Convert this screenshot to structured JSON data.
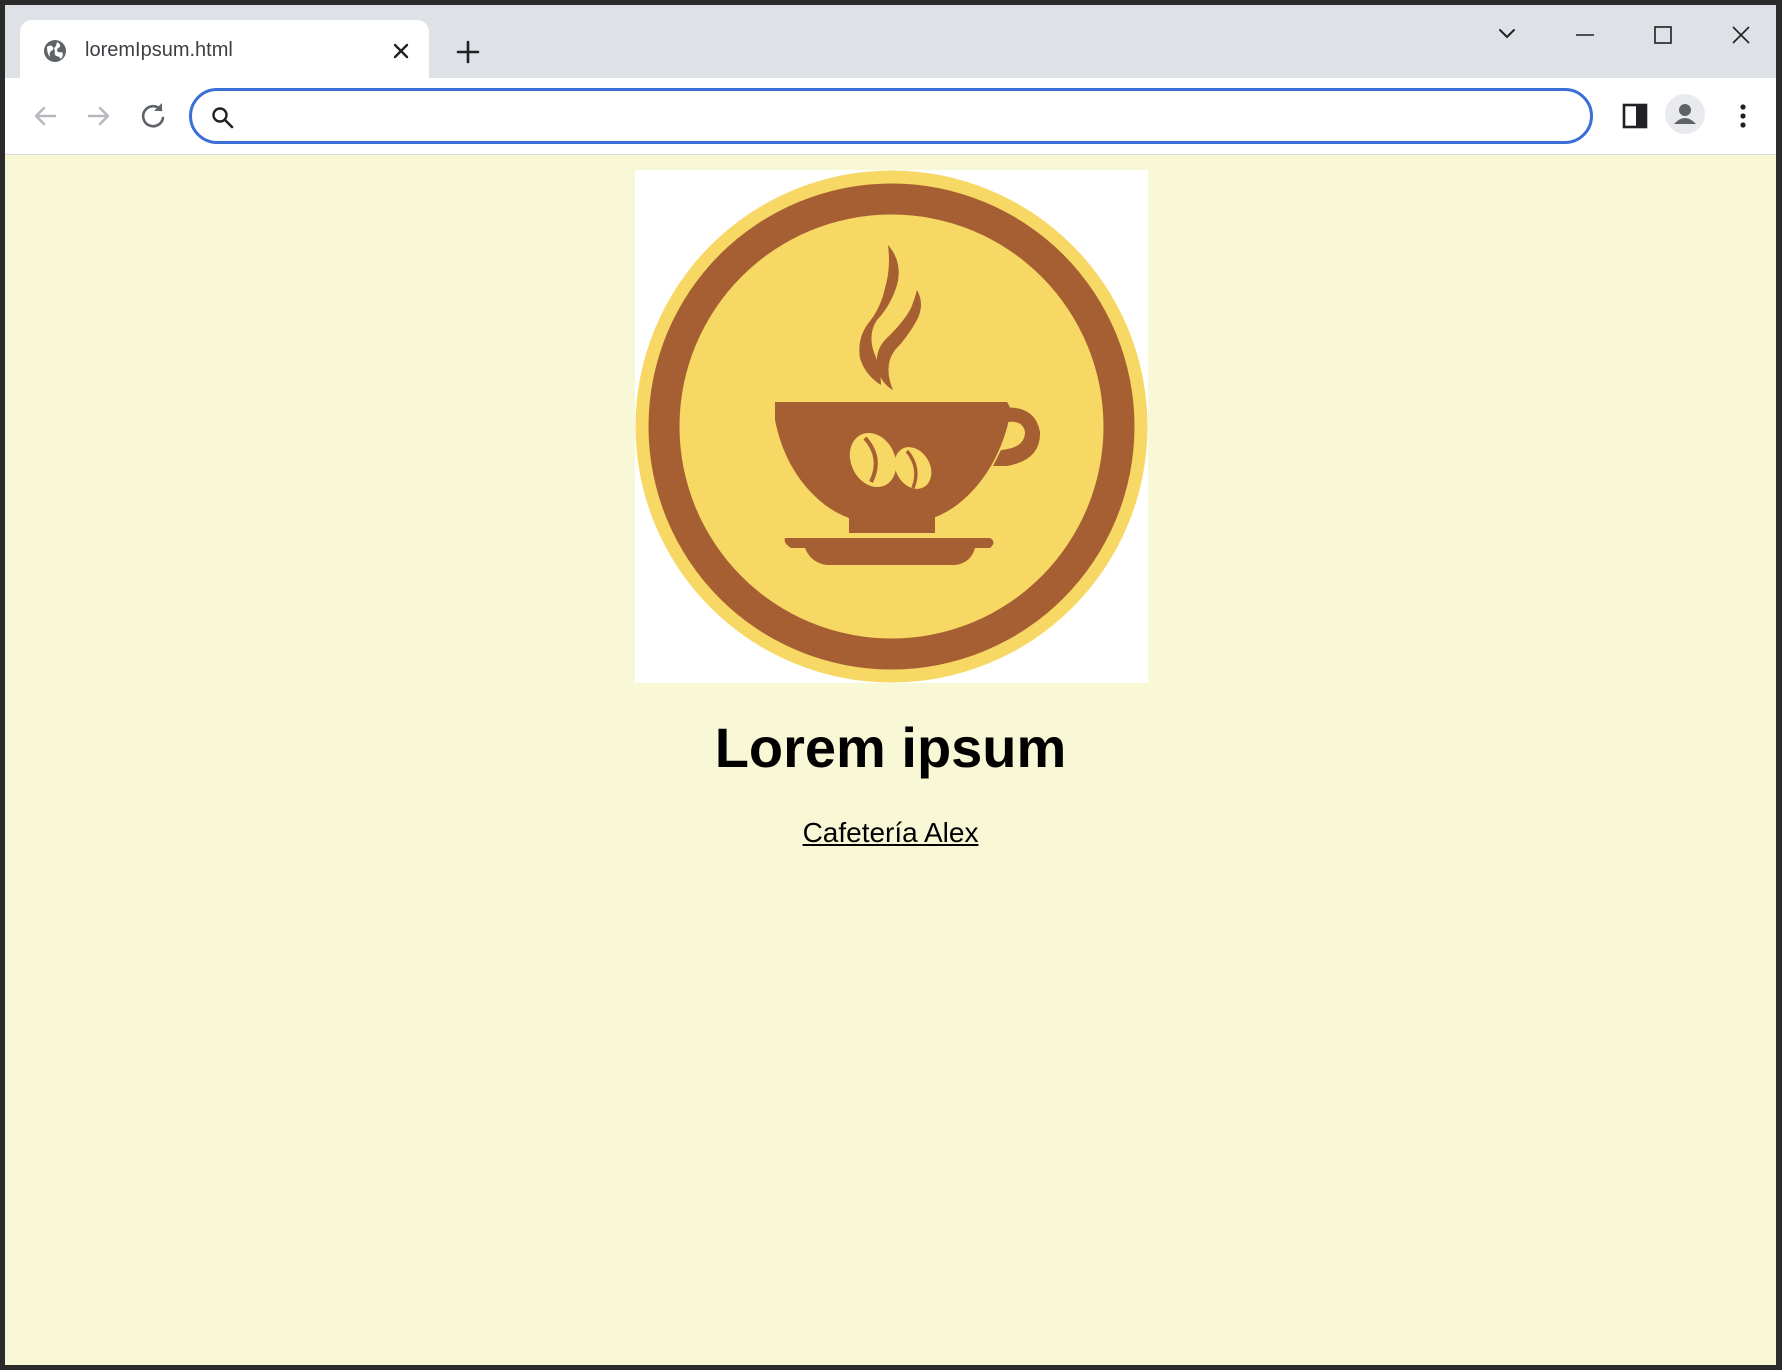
{
  "browser": {
    "tab": {
      "title": "loremIpsum.html",
      "favicon": "globe-icon",
      "close_icon": "close-icon"
    },
    "new_tab_icon": "plus-icon",
    "window_controls": [
      "chevron-down-icon",
      "minimize-icon",
      "maximize-icon",
      "close-icon"
    ],
    "toolbar": {
      "back_icon": "arrow-left-icon",
      "forward_icon": "arrow-right-icon",
      "reload_icon": "reload-icon",
      "address_value": "",
      "address_placeholder": "",
      "search_icon": "search-icon",
      "side_panel_icon": "side-panel-icon",
      "profile_icon": "profile-icon",
      "menu_icon": "kebab-menu-icon"
    },
    "colors": {
      "tabstrip_bg": "#dee1e6",
      "omnibox_border": "#3b6fd6",
      "page_bg": "#f9f8d6"
    }
  },
  "page": {
    "logo": {
      "name": "coffee-cup-logo",
      "colors": {
        "ring": "#a65f32",
        "fill": "#f7d864",
        "background": "#ffffff"
      }
    },
    "heading": "Lorem ipsum",
    "link_text": "Cafetería Alex"
  }
}
